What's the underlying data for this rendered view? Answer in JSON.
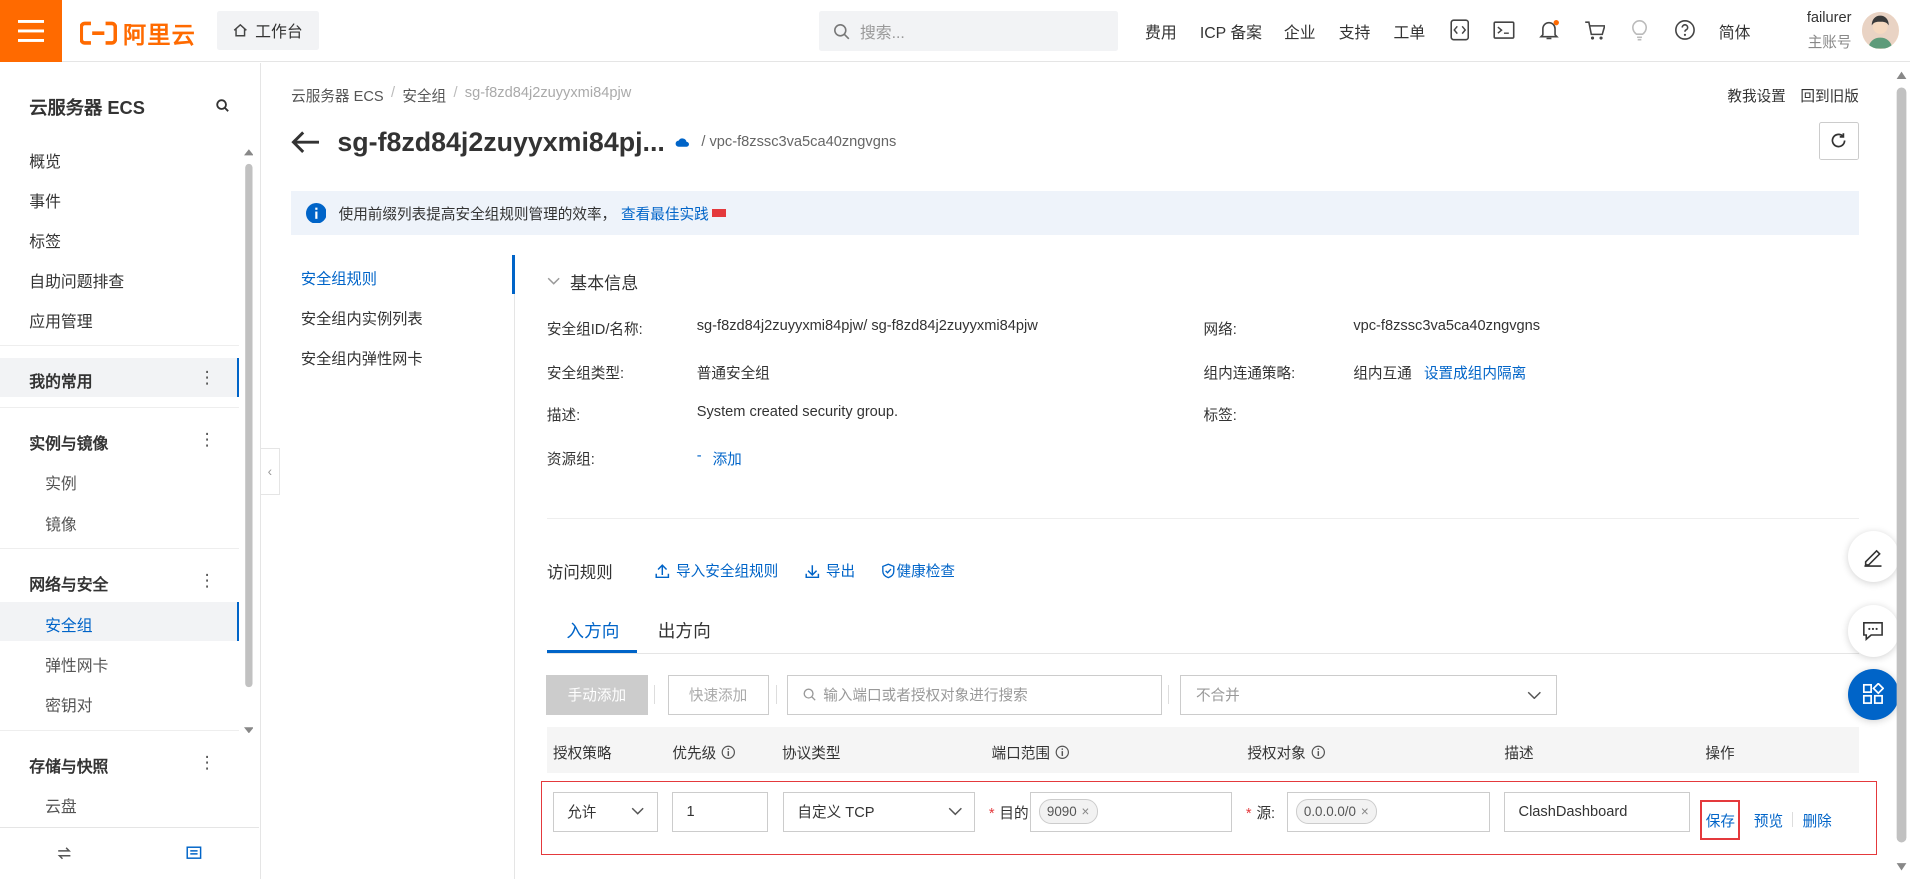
{
  "brand": {
    "logo_text": "阿里云",
    "accent": "#ff6a00",
    "link_color": "#0064c8",
    "alert_color": "#e4393c"
  },
  "topbar": {
    "workbench_label": "工作台",
    "search_placeholder": "搜索...",
    "nav": [
      "费用",
      "ICP 备案",
      "企业",
      "支持",
      "工单"
    ],
    "icons": [
      "code-icon",
      "terminal-icon",
      "bell-icon",
      "cart-icon",
      "lightbulb-icon",
      "help-icon"
    ],
    "lang": "简体",
    "user": {
      "name": "failurer",
      "role": "主账号"
    }
  },
  "sidebar": {
    "title": "云服务器 ECS",
    "items": [
      "概览",
      "事件",
      "标签",
      "自助问题排查",
      "应用管理"
    ],
    "groups": [
      {
        "label": "我的常用",
        "children": []
      },
      {
        "label": "实例与镜像",
        "children": [
          "实例",
          "镜像"
        ]
      },
      {
        "label": "网络与安全",
        "children": [
          "安全组",
          "弹性网卡",
          "密钥对"
        ]
      },
      {
        "label": "存储与快照",
        "children": [
          "云盘"
        ]
      }
    ],
    "active": "安全组",
    "bottom_icons": [
      "swap-icon",
      "list-icon"
    ]
  },
  "page": {
    "breadcrumb": [
      "云服务器 ECS",
      "安全组",
      "sg-f8zd84j2zuyyxmi84pjw"
    ],
    "help_link": "教我设置",
    "old_version_link": "回到旧版",
    "title": "sg-f8zd84j2zuyyxmi84pj...",
    "vpc": "/ vpc-f8zssc3va5ca40zngvgns",
    "notice": {
      "text": "使用前缀列表提高安全组规则管理的效率，",
      "link": "查看最佳实践"
    }
  },
  "left_nav": [
    "安全组规则",
    "安全组内实例列表",
    "安全组内弹性网卡"
  ],
  "basic_info": {
    "title": "基本信息",
    "id_label": "安全组ID/名称:",
    "id_value": "sg-f8zd84j2zuyyxmi84pjw/ sg-f8zd84j2zuyyxmi84pjw",
    "network_label": "网络:",
    "network_value": "vpc-f8zssc3va5ca40zngvgns",
    "type_label": "安全组类型:",
    "type_value": "普通安全组",
    "policy_label": "组内连通策略:",
    "policy_value": "组内互通",
    "policy_link": "设置成组内隔离",
    "desc_label": "描述:",
    "desc_value": "System created security group.",
    "tags_label": "标签:",
    "rg_label": "资源组:",
    "rg_value": "-",
    "rg_link": "添加"
  },
  "rules": {
    "title": "访问规则",
    "actions": [
      "导入安全组规则",
      "导出",
      "健康检查"
    ],
    "tabs": [
      "入方向",
      "出方向"
    ],
    "active_tab": "入方向",
    "toolbar": {
      "manual_add": "手动添加",
      "quick_add": "快速添加",
      "search_placeholder": "输入端口或者授权对象进行搜索",
      "merge_placeholder": "不合并"
    },
    "columns": [
      "授权策略",
      "优先级",
      "协议类型",
      "端口范围",
      "授权对象",
      "描述",
      "操作"
    ],
    "edit_row": {
      "policy": "允许",
      "priority": "1",
      "protocol": "自定义 TCP",
      "port_label": "目的:",
      "port_tag": "9090",
      "source_label": "源:",
      "source_tag": "0.0.0.0/0",
      "description": "ClashDashboard",
      "actions": [
        "保存",
        "预览",
        "删除"
      ]
    }
  }
}
